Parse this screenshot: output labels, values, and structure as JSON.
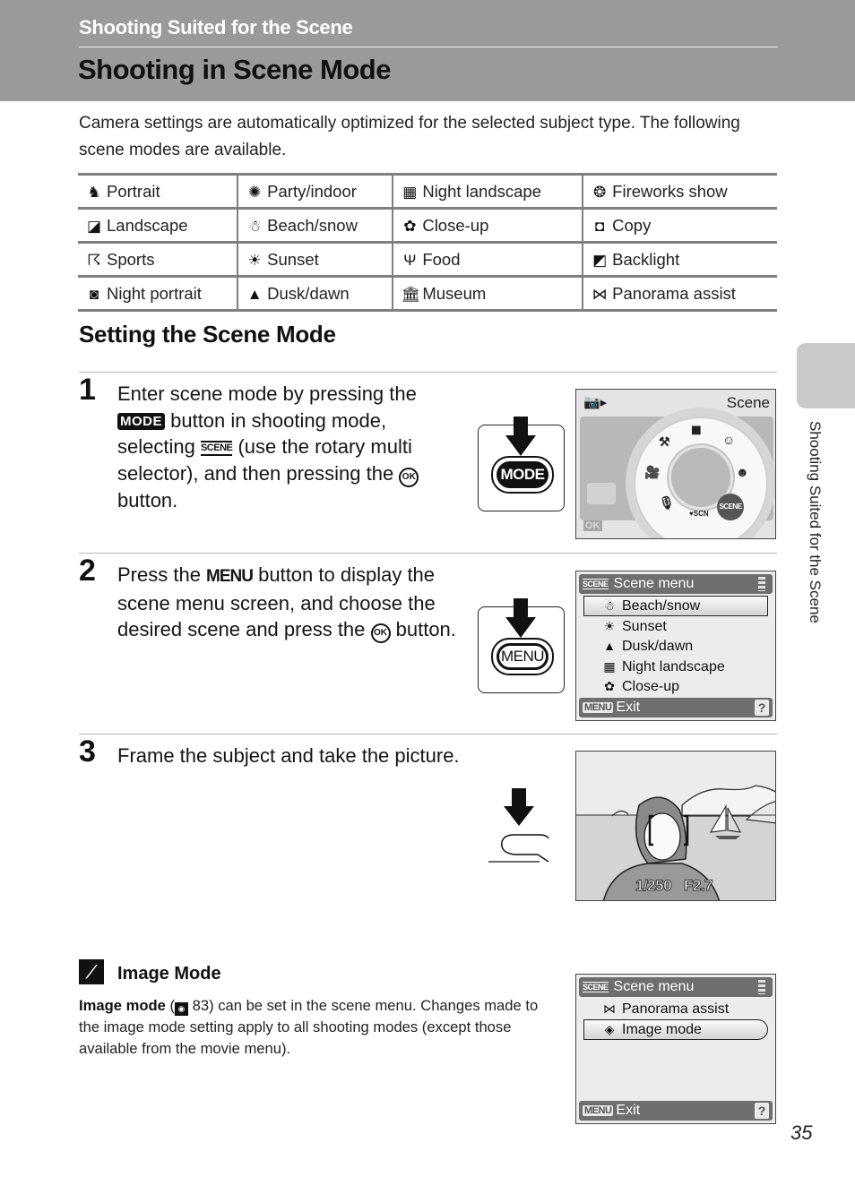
{
  "header": {
    "section": "Shooting Suited for the Scene",
    "title": "Shooting in Scene Mode"
  },
  "intro": "Camera settings are automatically optimized for the selected subject type. The following scene modes are available.",
  "scene_table": {
    "rows": [
      [
        {
          "icon": "portrait-icon",
          "glyph": "♞",
          "label": "Portrait"
        },
        {
          "icon": "party-indoor-icon",
          "glyph": "✺",
          "label": "Party/indoor"
        },
        {
          "icon": "night-landscape-icon",
          "glyph": "▦",
          "label": "Night landscape"
        },
        {
          "icon": "fireworks-icon",
          "glyph": "❂",
          "label": "Fireworks show"
        }
      ],
      [
        {
          "icon": "landscape-icon",
          "glyph": "◪",
          "label": "Landscape"
        },
        {
          "icon": "beach-snow-icon",
          "glyph": "☃",
          "label": "Beach/snow"
        },
        {
          "icon": "close-up-icon",
          "glyph": "✿",
          "label": "Close-up"
        },
        {
          "icon": "copy-icon",
          "glyph": "◘",
          "label": "Copy"
        }
      ],
      [
        {
          "icon": "sports-icon",
          "glyph": "☈",
          "label": "Sports"
        },
        {
          "icon": "sunset-icon",
          "glyph": "☀",
          "label": "Sunset"
        },
        {
          "icon": "food-icon",
          "glyph": "Ψ",
          "label": "Food"
        },
        {
          "icon": "backlight-icon",
          "glyph": "◩",
          "label": "Backlight"
        }
      ],
      [
        {
          "icon": "night-portrait-icon",
          "glyph": "◙",
          "label": "Night portrait"
        },
        {
          "icon": "dusk-dawn-icon",
          "glyph": "▲",
          "label": "Dusk/dawn"
        },
        {
          "icon": "museum-icon",
          "glyph": "🏛",
          "label": "Museum"
        },
        {
          "icon": "panorama-assist-icon",
          "glyph": "⋈",
          "label": "Panorama assist"
        }
      ]
    ]
  },
  "setting_heading": "Setting the Scene Mode",
  "steps": [
    {
      "number": "1",
      "parts": {
        "a": "Enter scene mode by pressing the",
        "mode": "MODE",
        "b": " button in shooting mode, selecting ",
        "scene": "SCENE",
        "c": " (use the rotary multi selector), and then pressing the ",
        "ok": "OK",
        "d": " button."
      },
      "button_label": "MODE"
    },
    {
      "number": "2",
      "parts": {
        "a": "Press the ",
        "menu": "MENU",
        "b": " button to display the scene menu screen, and choose the desired scene and press the ",
        "ok": "OK",
        "c": " button."
      },
      "button_label": "MENU"
    },
    {
      "number": "3",
      "text": "Frame the subject and take the picture."
    }
  ],
  "screen_dial": {
    "header_label": "Scene",
    "ok_label": "OK",
    "selected_label": "SCENE",
    "items": [
      "setup-icon",
      "camera-icon",
      "smile-icon",
      "face-priority-icon",
      "scene-icon",
      "scene-auto-icon",
      "voice-recording-icon",
      "movie-icon"
    ]
  },
  "screen_scene_menu": {
    "title_tag": "SCENE",
    "title": "Scene menu",
    "items": [
      {
        "glyph": "☃",
        "label": "Beach/snow",
        "selected": true
      },
      {
        "glyph": "☀",
        "label": "Sunset"
      },
      {
        "glyph": "▲",
        "label": "Dusk/dawn"
      },
      {
        "glyph": "▦",
        "label": "Night landscape"
      },
      {
        "glyph": "✿",
        "label": "Close-up"
      }
    ],
    "footer_tag": "MENU",
    "footer_label": "Exit",
    "help": "?"
  },
  "screen_photo": {
    "shutter": "1/250",
    "aperture": "F2.7"
  },
  "note": {
    "title": "Image Mode",
    "bold": "Image mode",
    "ref": "83",
    "text": " can be set in the scene menu. Changes made to the image mode setting apply to all shooting modes (except those available from the movie menu)."
  },
  "screen_image_mode": {
    "title_tag": "SCENE",
    "title": "Scene menu",
    "items": [
      {
        "glyph": "⋈",
        "label": "Panorama assist"
      },
      {
        "glyph": "◈",
        "label": "Image mode",
        "selected": true
      }
    ],
    "footer_tag": "MENU",
    "footer_label": "Exit",
    "help": "?"
  },
  "side_tab": "Shooting Suited for the Scene",
  "page_number": "35"
}
